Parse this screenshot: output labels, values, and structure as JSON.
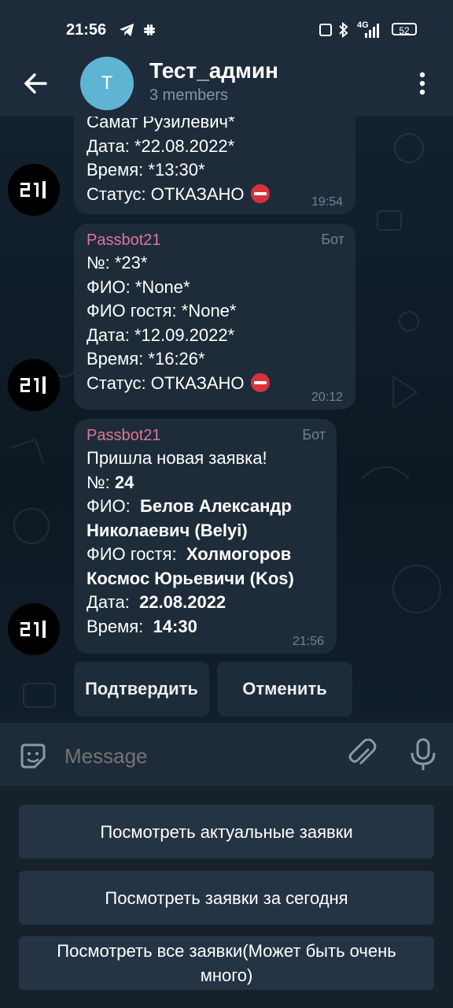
{
  "status_bar": {
    "time": "21:56",
    "network": "4G",
    "battery": "52"
  },
  "header": {
    "title": "Тест_админ",
    "subtitle": "3 members",
    "avatar_letter": "T"
  },
  "messages": [
    {
      "lines": [
        "Самат Рузилевич*",
        "Дата:  *22.08.2022*",
        "Время:  *13:30*",
        "Статус: ОТКАЗАНО"
      ],
      "time": "19:54"
    },
    {
      "sender": "Passbot21",
      "bot_label": "Бот",
      "lines": [
        "№: *23*",
        "ФИО:  *None*",
        "ФИО гостя:  *None*",
        "Дата:  *12.09.2022*",
        "Время:  *16:26*",
        "Статус: ОТКАЗАНО"
      ],
      "time": "20:12"
    },
    {
      "sender": "Passbot21",
      "bot_label": "Бот",
      "title": "Пришла новая заявка!",
      "no_label": "№:",
      "no_value": "24",
      "fio_label": "ФИО:",
      "fio_value_1": "Белов Александр",
      "fio_value_2": "Николаевич (Belyi)",
      "guest_label": "ФИО гостя:",
      "guest_value_1": "Холмогоров",
      "guest_value_2": "Космос Юрьевичи (Kos)",
      "date_label": "Дата:",
      "date_value": "22.08.2022",
      "time_label": "Время:",
      "time_value": "14:30",
      "time": "21:56"
    }
  ],
  "inline_buttons": {
    "confirm": "Подтвердить",
    "cancel": "Отменить"
  },
  "input": {
    "placeholder": "Message"
  },
  "reply_keyboard": [
    "Посмотреть актуальные заявки",
    "Посмотреть заявки за сегодня",
    "Посмотреть все заявки(Может быть очень много)"
  ],
  "avatar_text": "21"
}
